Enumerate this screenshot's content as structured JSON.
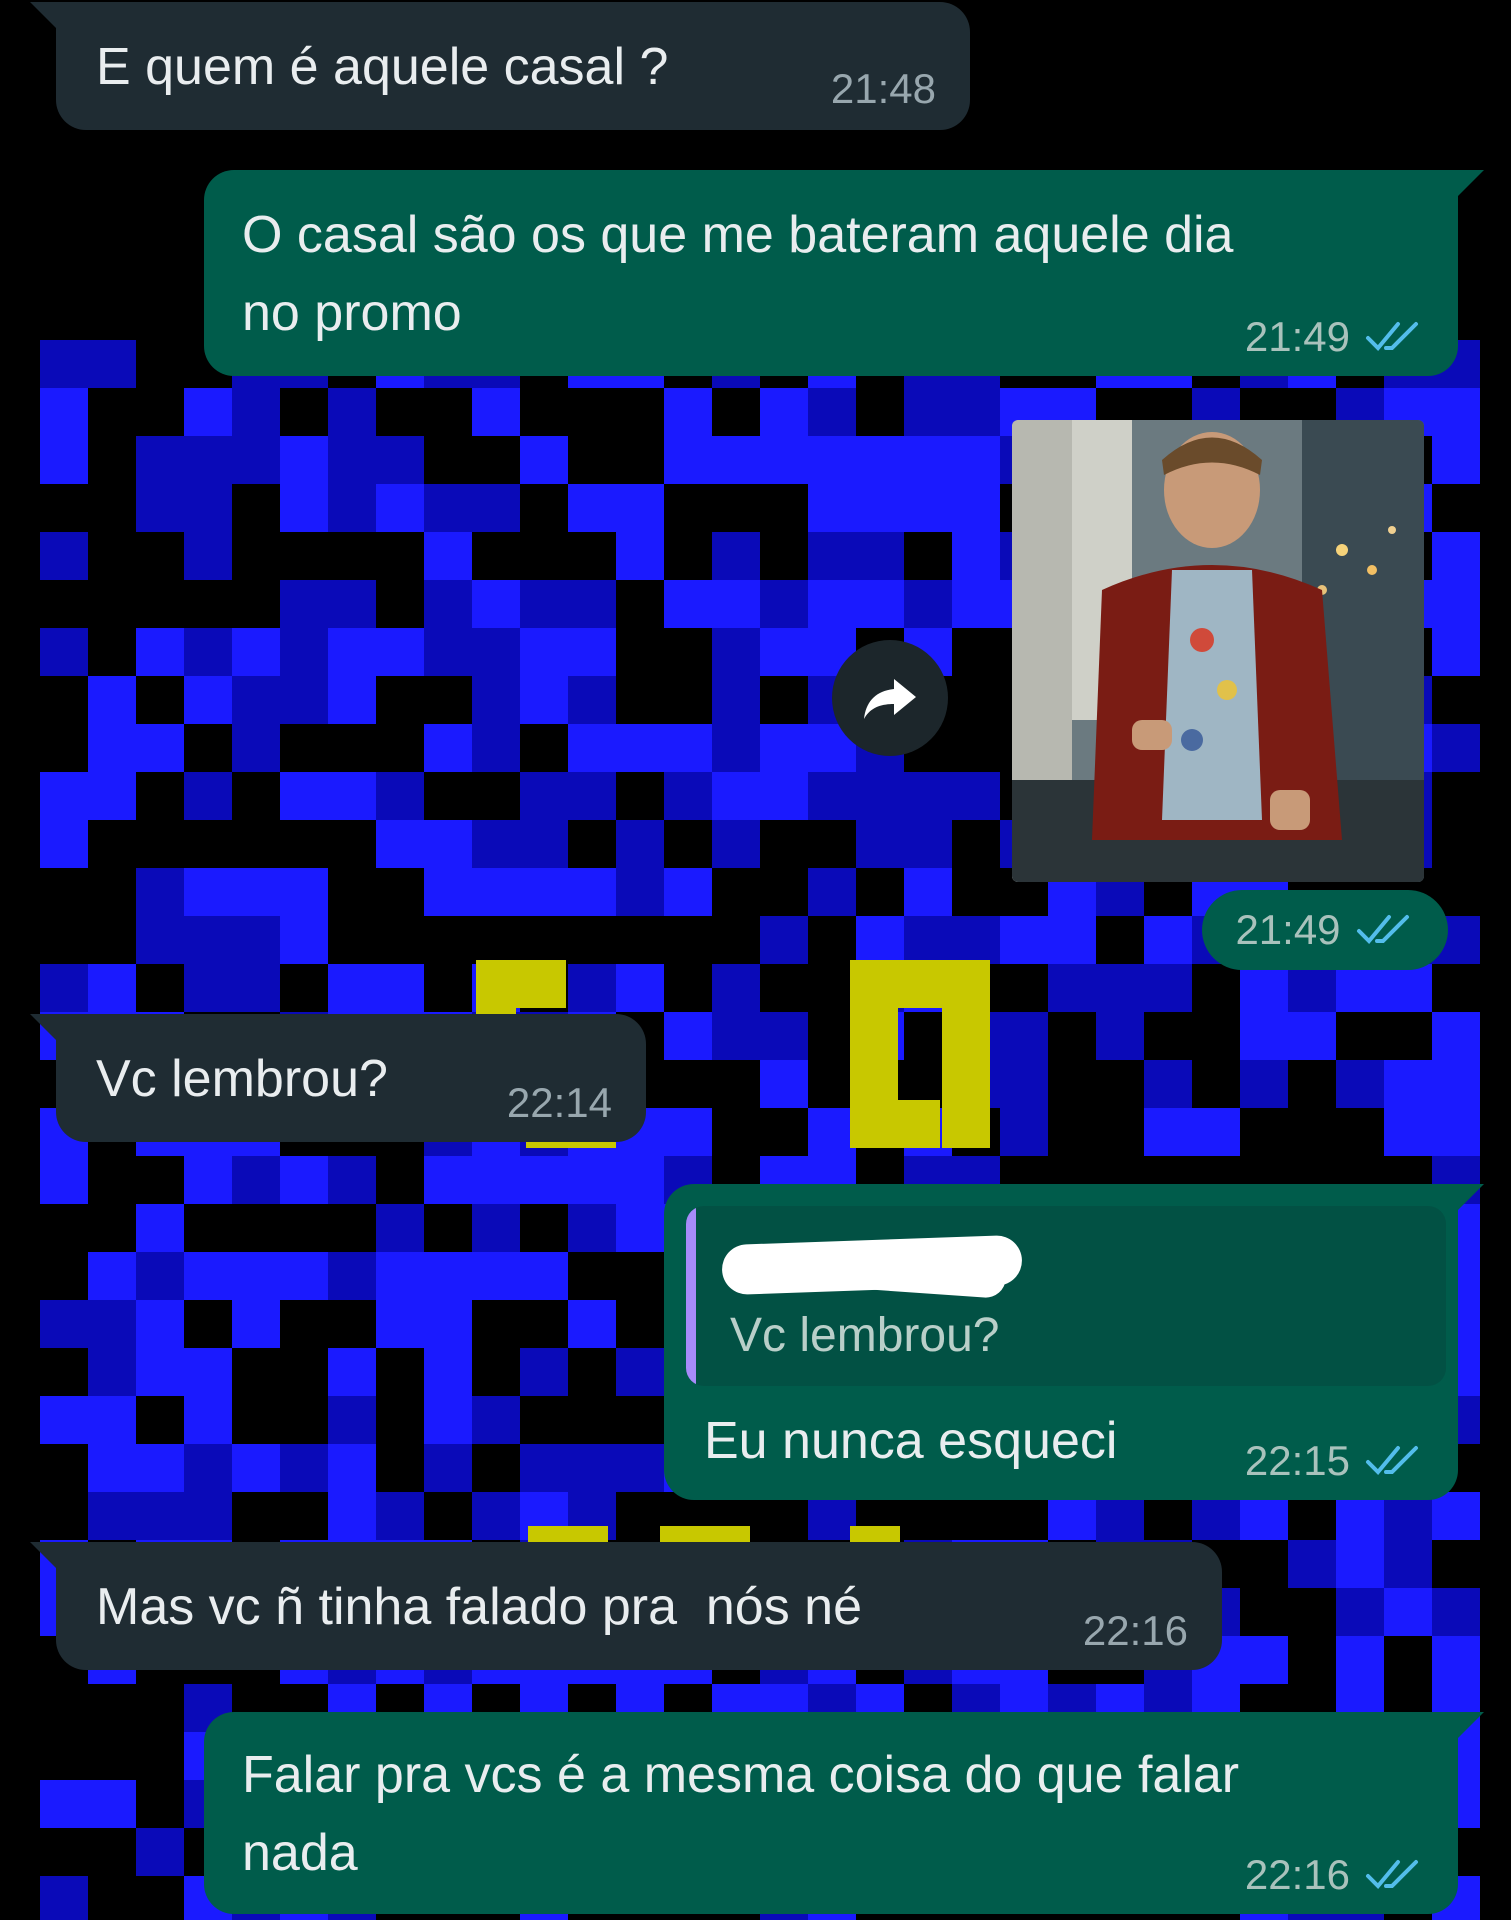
{
  "colors": {
    "wallpaper_bg": "#000000",
    "wallpaper_blue": "#1a1aff",
    "wallpaper_blue_dark": "#0a0ab8",
    "wallpaper_yellow": "#c8c800",
    "incoming_bubble": "#1f2c33",
    "outgoing_bubble": "#005c4b",
    "read_ticks": "#53bdeb"
  },
  "messages": [
    {
      "direction": "incoming",
      "text": "E quem é aquele casal ?",
      "time": "21:48"
    },
    {
      "direction": "outgoing",
      "text": "O casal são os que me bateram aquele dia no promo",
      "time": "21:49",
      "status_icon": "double-check-read-icon"
    },
    {
      "direction": "outgoing",
      "type": "image",
      "time": "21:49",
      "status_icon": "double-check-read-icon",
      "forward_icon": "forward-arrow-icon"
    },
    {
      "direction": "incoming",
      "text": "Vc lembrou?",
      "time": "22:14"
    },
    {
      "direction": "outgoing",
      "quoted_text": "Vc lembrou?",
      "text": "Eu nunca esqueci",
      "time": "22:15",
      "status_icon": "double-check-read-icon"
    },
    {
      "direction": "incoming",
      "text": "Mas vc ñ tinha falado pra  nós né",
      "time": "22:16"
    },
    {
      "direction": "outgoing",
      "text": "Falar pra vcs é a mesma coisa do que falar nada",
      "time": "22:16",
      "status_icon": "double-check-read-icon"
    }
  ]
}
